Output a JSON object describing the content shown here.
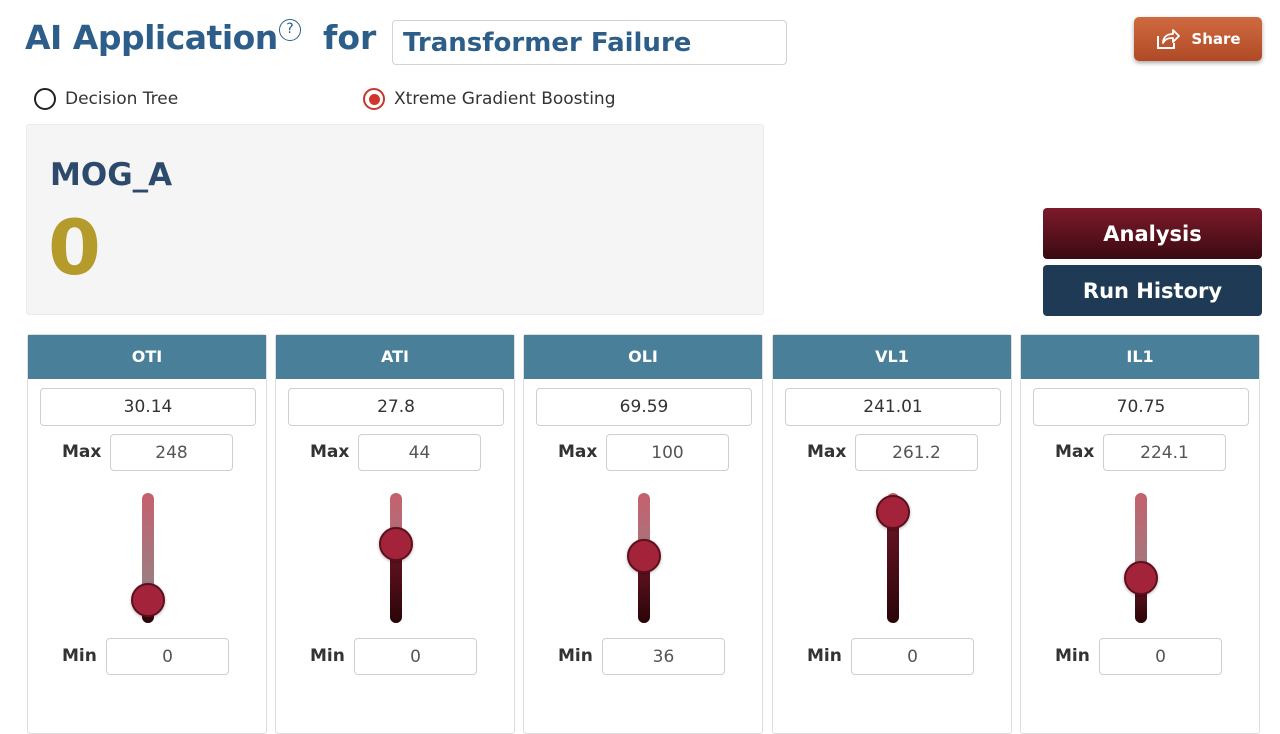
{
  "header": {
    "title": "AI Application",
    "help_icon": "question-circle-icon",
    "for_label": "for",
    "target": "Transformer Failure",
    "share_label": "Share",
    "share_icon": "share-icon"
  },
  "model_options": [
    {
      "label": "Decision Tree",
      "selected": false
    },
    {
      "label": "Xtreme Gradient Boosting",
      "selected": true
    }
  ],
  "result": {
    "name": "MOG_A",
    "value": "0"
  },
  "actions": {
    "analysis_label": "Analysis",
    "run_history_label": "Run History"
  },
  "parameters": [
    {
      "name": "OTI",
      "value": "30.14",
      "max_label": "Max",
      "max": "248",
      "min_label": "Min",
      "min": "0",
      "level": 0.12
    },
    {
      "name": "ATI",
      "value": "27.8",
      "max_label": "Max",
      "max": "44",
      "min_label": "Min",
      "min": "0",
      "level": 0.63
    },
    {
      "name": "OLI",
      "value": "69.59",
      "max_label": "Max",
      "max": "100",
      "min_label": "Min",
      "min": "36",
      "level": 0.52
    },
    {
      "name": "VL1",
      "value": "241.01",
      "max_label": "Max",
      "max": "261.2",
      "min_label": "Min",
      "min": "0",
      "level": 0.92
    },
    {
      "name": "IL1",
      "value": "70.75",
      "max_label": "Max",
      "max": "224.1",
      "min_label": "Min",
      "min": "0",
      "level": 0.32
    }
  ],
  "colors": {
    "title": "#2d5e8a",
    "share": "#c65a33",
    "card_header": "#4a7f99",
    "slider_thumb": "#a3243a",
    "result_value": "#b59a2c",
    "analysis": "#5a1220",
    "run_history": "#1f3a55"
  }
}
